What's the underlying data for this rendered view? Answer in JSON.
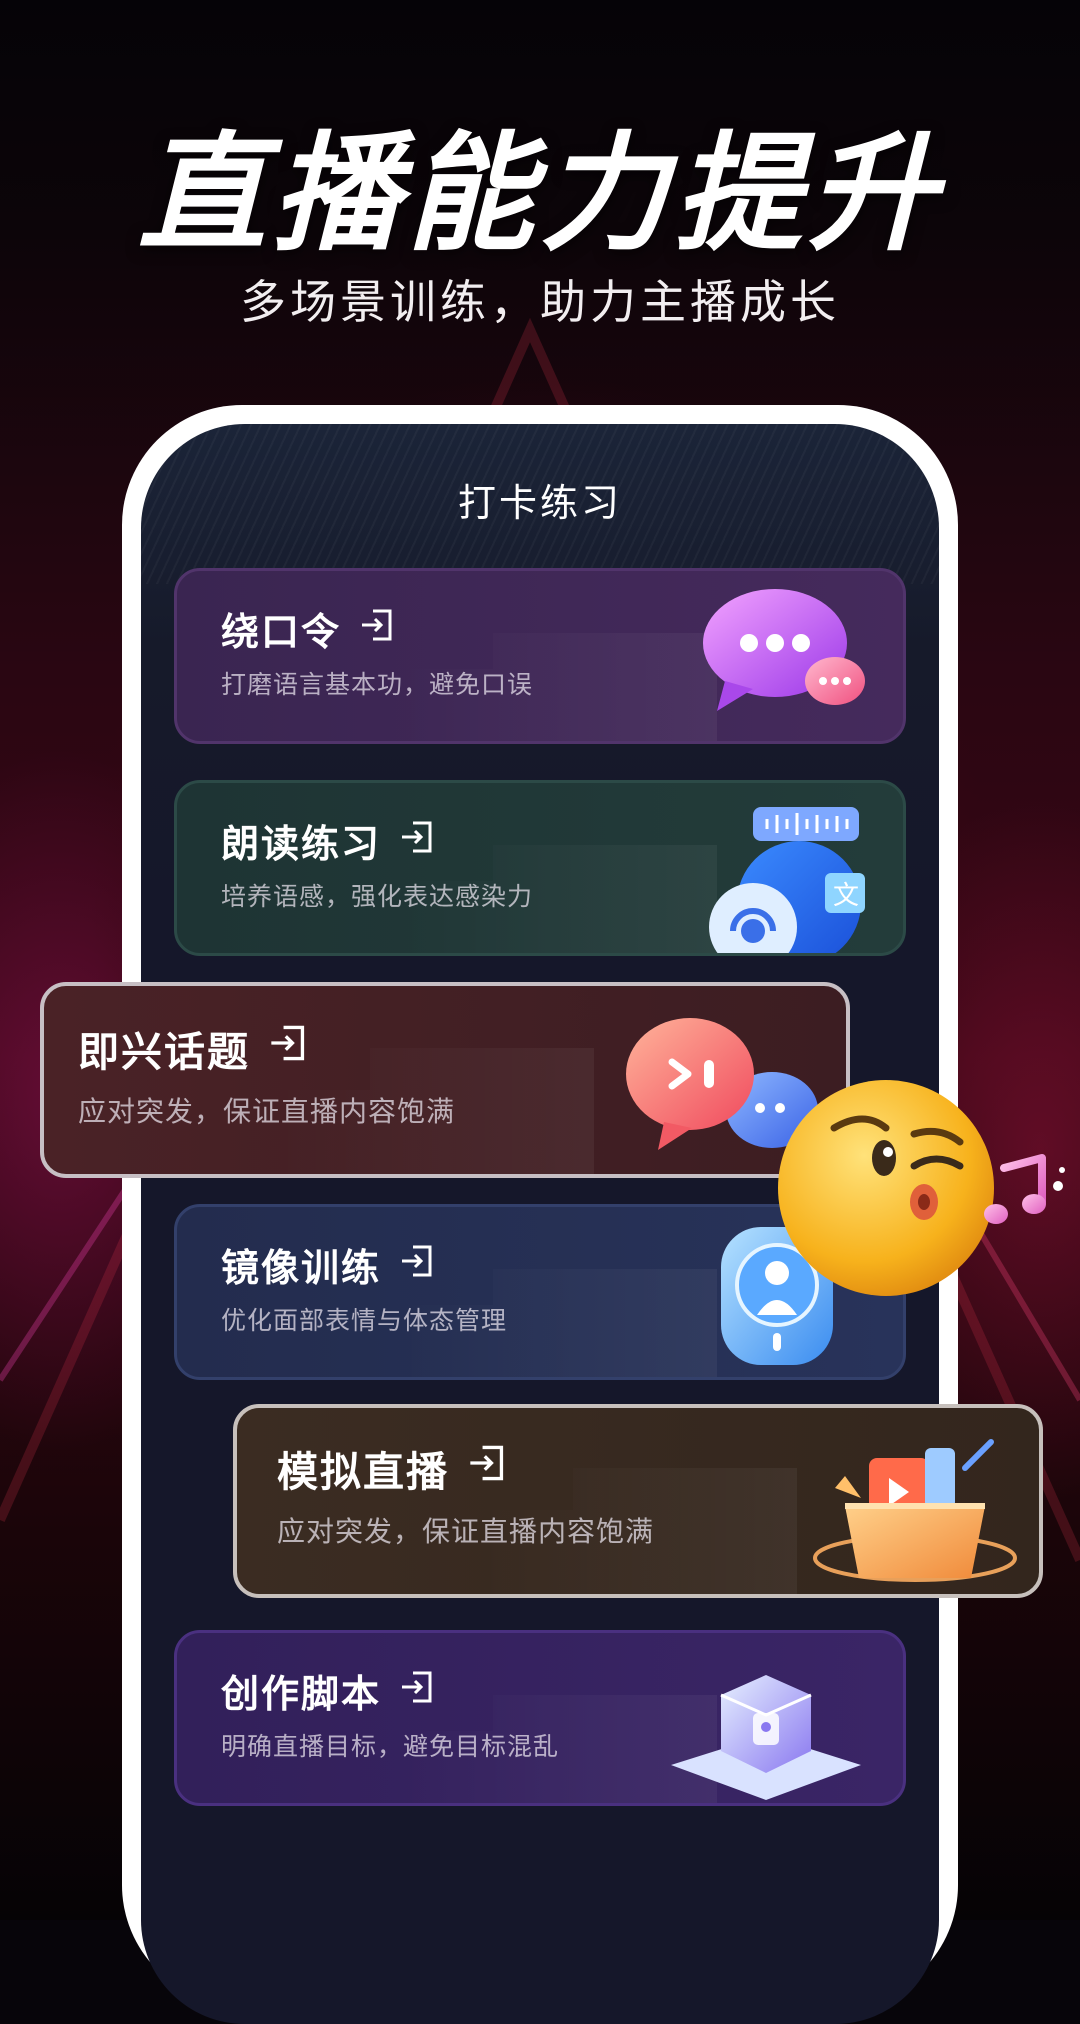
{
  "headline": "直播能力提升",
  "subline": "多场景训练，助力主播成长",
  "screen": {
    "title": "打卡练习"
  },
  "cards": [
    {
      "title": "绕口令",
      "desc": "打磨语言基本功，避免口误",
      "icon": "chat-bubble-icon"
    },
    {
      "title": "朗读练习",
      "desc": "培养语感，强化表达感染力",
      "icon": "headset-translate-icon"
    },
    {
      "title": "即兴话题",
      "desc": "应对突发，保证直播内容饱满",
      "icon": "play-chat-bubble-icon"
    },
    {
      "title": "镜像训练",
      "desc": "优化面部表情与体态管理",
      "icon": "mirror-person-icon"
    },
    {
      "title": "模拟直播",
      "desc": "应对突发，保证直播内容饱满",
      "icon": "gift-box-icon"
    },
    {
      "title": "创作脚本",
      "desc": "明确直播目标，避免目标混乱",
      "icon": "lock-cube-icon"
    }
  ],
  "decorations": {
    "emoji": "kissing-winking-emoji-icon",
    "music": "music-note-icon"
  }
}
